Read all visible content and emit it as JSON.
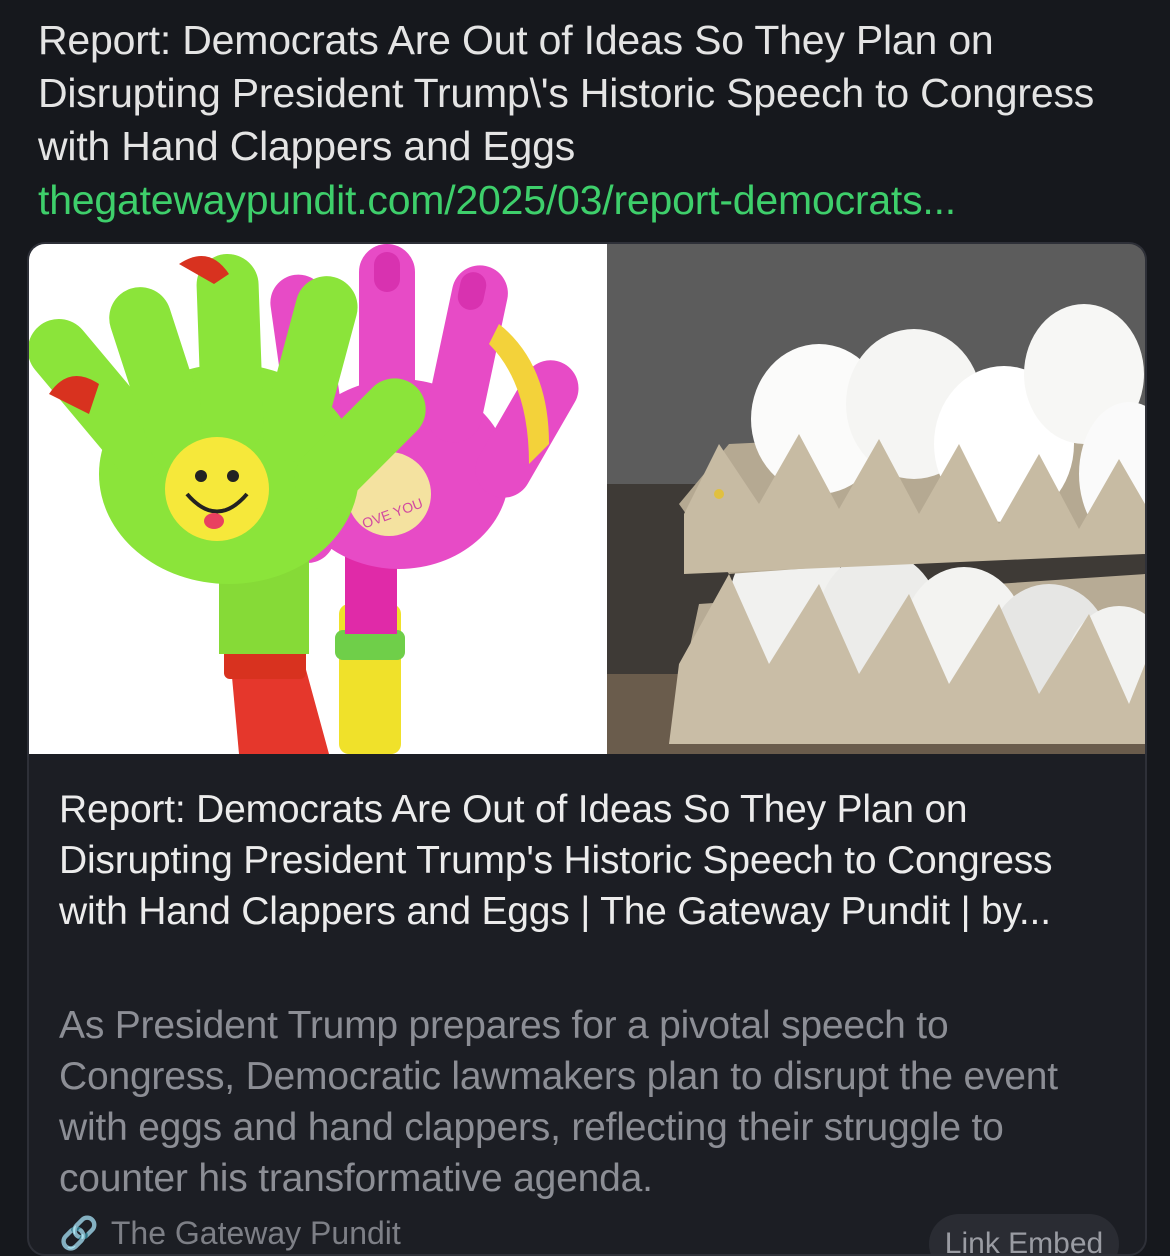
{
  "post": {
    "text": "Report: Democrats Are Out of Ideas So They Plan on Disrupting President Trump\\'s Historic Speech to Congress with Hand Clappers and Eggs",
    "link": "thegatewaypundit.com/2025/03/report-democrats..."
  },
  "card": {
    "image_alt": "Hand clapper toys and eggs in cartons",
    "sticker_text": "LOVE YOU",
    "title": "Report: Democrats Are Out of Ideas So They Plan on Disrupting President Trump's Historic Speech to Congress with Hand Clappers and Eggs | The Gateway Pundit | by...",
    "description": "As President Trump prepares for a pivotal speech to Congress, Democratic lawmakers plan to disrupt the event with eggs and hand clappers, reflecting their struggle to counter his transformative agenda.",
    "source": "The Gateway Pundit",
    "footer_button": "Link Embed"
  },
  "colors": {
    "background": "#16181d",
    "link": "#3ecf6b",
    "muted_text": "#8c8e95"
  }
}
